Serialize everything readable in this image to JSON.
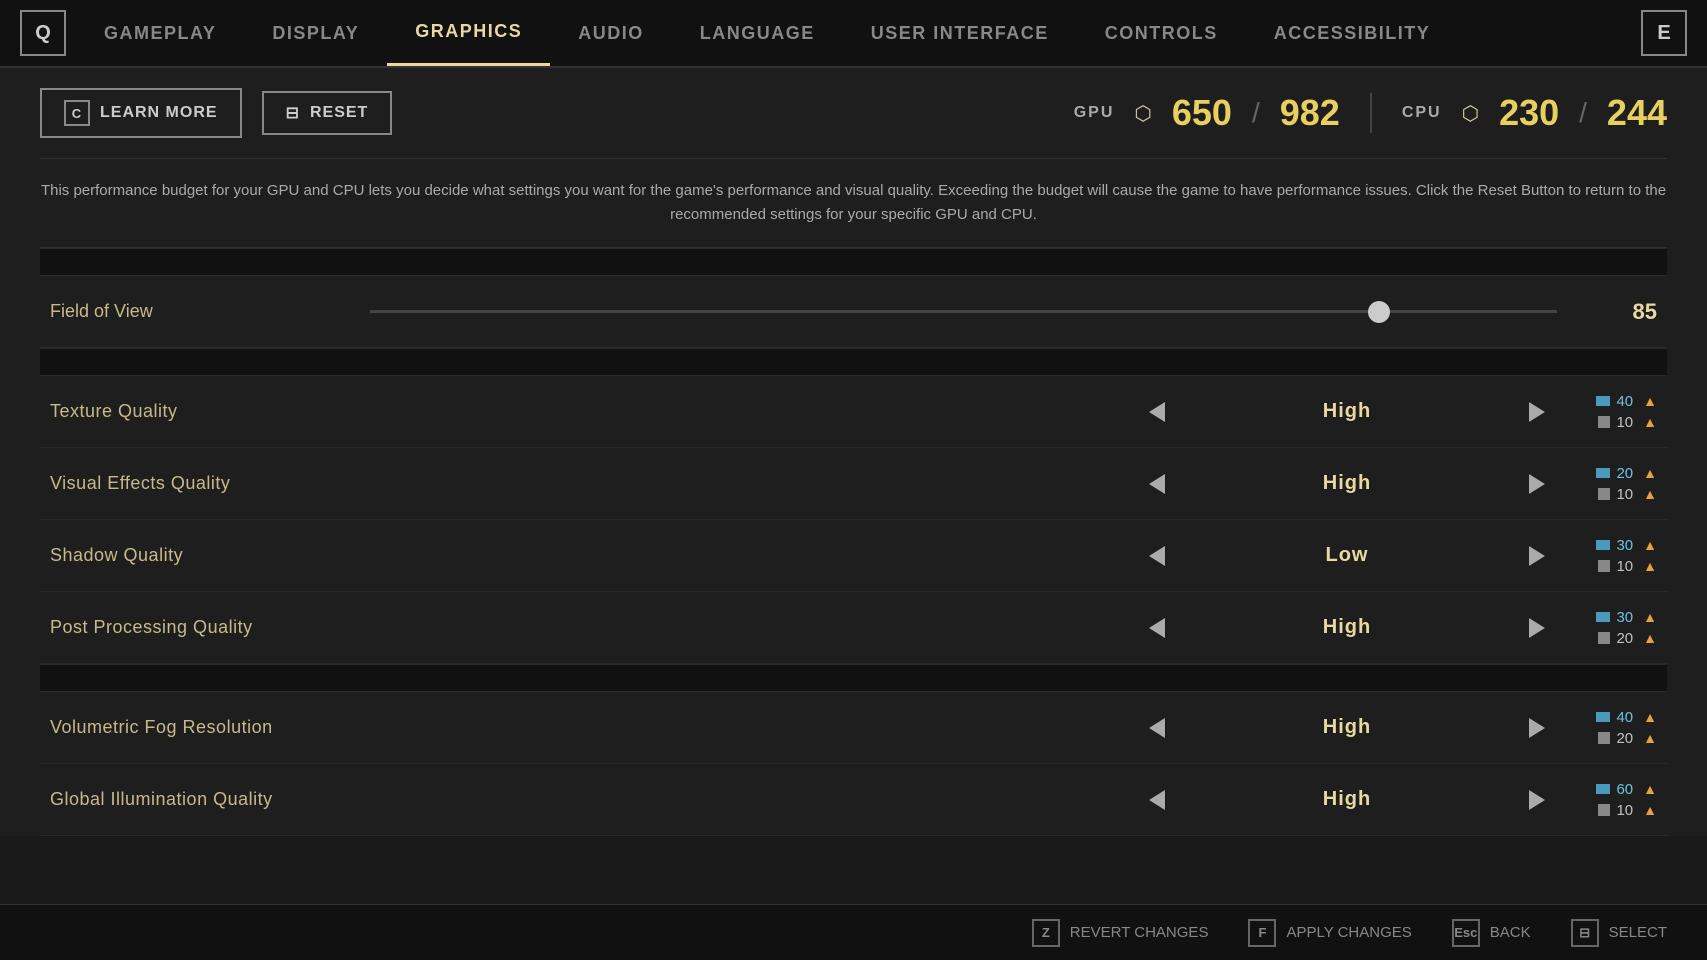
{
  "nav": {
    "left_key": "Q",
    "right_key": "E",
    "tabs": [
      {
        "id": "gameplay",
        "label": "GAMEPLAY",
        "active": false
      },
      {
        "id": "display",
        "label": "DISPLAY",
        "active": false
      },
      {
        "id": "graphics",
        "label": "GRAPHICS",
        "active": true
      },
      {
        "id": "audio",
        "label": "AUDIO",
        "active": false
      },
      {
        "id": "language",
        "label": "LANGUAGE",
        "active": false
      },
      {
        "id": "user_interface",
        "label": "USER INTERFACE",
        "active": false
      },
      {
        "id": "controls",
        "label": "CONTROLS",
        "active": false
      },
      {
        "id": "accessibility",
        "label": "ACCESSIBILITY",
        "active": false
      }
    ]
  },
  "toolbar": {
    "learn_more_key": "C",
    "learn_more_label": "LEARN MORE",
    "reset_icon": "⊟",
    "reset_label": "RESET",
    "gpu_label": "GPU",
    "gpu_current": "650",
    "gpu_separator": "/",
    "gpu_max": "982",
    "cpu_label": "CPU",
    "cpu_current": "230",
    "cpu_separator": "/",
    "cpu_max": "244"
  },
  "description": "This performance budget for your GPU and CPU lets you decide what settings you want for the game's performance and visual quality. Exceeding the budget will cause the game to have performance issues. Click the Reset Button to return to the recommended settings for your specific GPU and CPU.",
  "settings": {
    "fov": {
      "label": "Field of View",
      "value": "85",
      "slider_percent": 85
    },
    "sections": [
      {
        "items": [
          {
            "name": "Texture Quality",
            "value": "High",
            "gpu_cost": "40",
            "cpu_cost": "10"
          },
          {
            "name": "Visual Effects Quality",
            "value": "High",
            "gpu_cost": "20",
            "cpu_cost": "10"
          },
          {
            "name": "Shadow Quality",
            "value": "Low",
            "gpu_cost": "30",
            "cpu_cost": "10"
          },
          {
            "name": "Post Processing Quality",
            "value": "High",
            "gpu_cost": "30",
            "cpu_cost": "20"
          }
        ]
      },
      {
        "items": [
          {
            "name": "Volumetric Fog Resolution",
            "value": "High",
            "gpu_cost": "40",
            "cpu_cost": "20"
          },
          {
            "name": "Global Illumination Quality",
            "value": "High",
            "gpu_cost": "60",
            "cpu_cost": "10"
          }
        ]
      }
    ]
  },
  "bottom": {
    "revert_key": "Z",
    "revert_label": "REVERT CHANGES",
    "apply_key": "F",
    "apply_label": "APPLY CHANGES",
    "back_key": "Esc",
    "back_label": "BACK",
    "select_key": "⊟",
    "select_label": "SELECT"
  }
}
